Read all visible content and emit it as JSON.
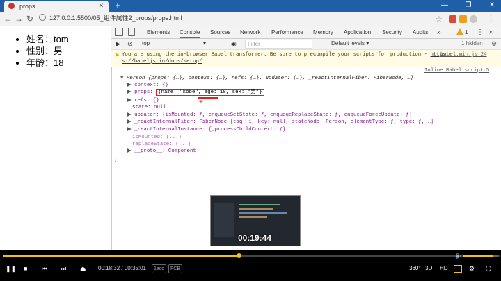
{
  "browser": {
    "tab_title": "props",
    "url": "127.0.0.1:5500/05_组件属性2_props/props.html"
  },
  "page": {
    "items": [
      "姓名：tom",
      "性别：男",
      "年龄：18"
    ]
  },
  "devtools": {
    "tabs": [
      "Elements",
      "Console",
      "Sources",
      "Network",
      "Performance",
      "Memory",
      "Application",
      "Security",
      "Audits"
    ],
    "active_tab": "Console",
    "warning_count": "1",
    "context": "top",
    "filter_placeholder": "Filter",
    "levels": "Default levels ▾",
    "hidden": "1 hidden",
    "warning_line1": "You are using the in-browser Babel transformer. Be sure to precompile your scripts for production - ",
    "warning_link1": "https",
    "warning_link_src": "babel.min.js:24",
    "warning_line2": "s://babeljs.io/docs/setup/",
    "inline_script": "Inline Babel script:5",
    "log": {
      "summary": "Person {props: {…}, context: {…}, refs: {…}, updater: {…}, _reactInternalFiber: FiberNode, …}",
      "context": "context: {}",
      "props_key": "props:",
      "props_value": "{name: \"kobe\", age: 18, sex: \"男\"}",
      "refs": "refs: {}",
      "state": "state: null",
      "updater": "updater: {isMounted: ƒ, enqueueSetState: ƒ, enqueueReplaceState: ƒ, enqueueForceUpdate: ƒ}",
      "fiber": "_reactInternalFiber: FiberNode {tag: 1, key: null, stateNode: Person, elementType: ƒ, type: ƒ, …}",
      "instance": "_reactInternalInstance: {_processChildContext: ƒ}",
      "isMounted": "isMounted: (...)",
      "replaceState": "replaceState: (...)",
      "proto": "__proto__: Component"
    }
  },
  "player": {
    "current_time": "00:18:32",
    "separator": "/",
    "total_time": "00:35:01",
    "pill1": "1acc",
    "pill2": "FCB",
    "hover_time": "00:19:44",
    "label_360": "360°",
    "label_3d": "3D",
    "label_hd": "HD",
    "progress": 0.475,
    "volume": 0.84
  },
  "colors": {
    "accent": "#f0c20d",
    "highlight_box": "#e02020",
    "tab_bar": "#1f5fa8"
  }
}
